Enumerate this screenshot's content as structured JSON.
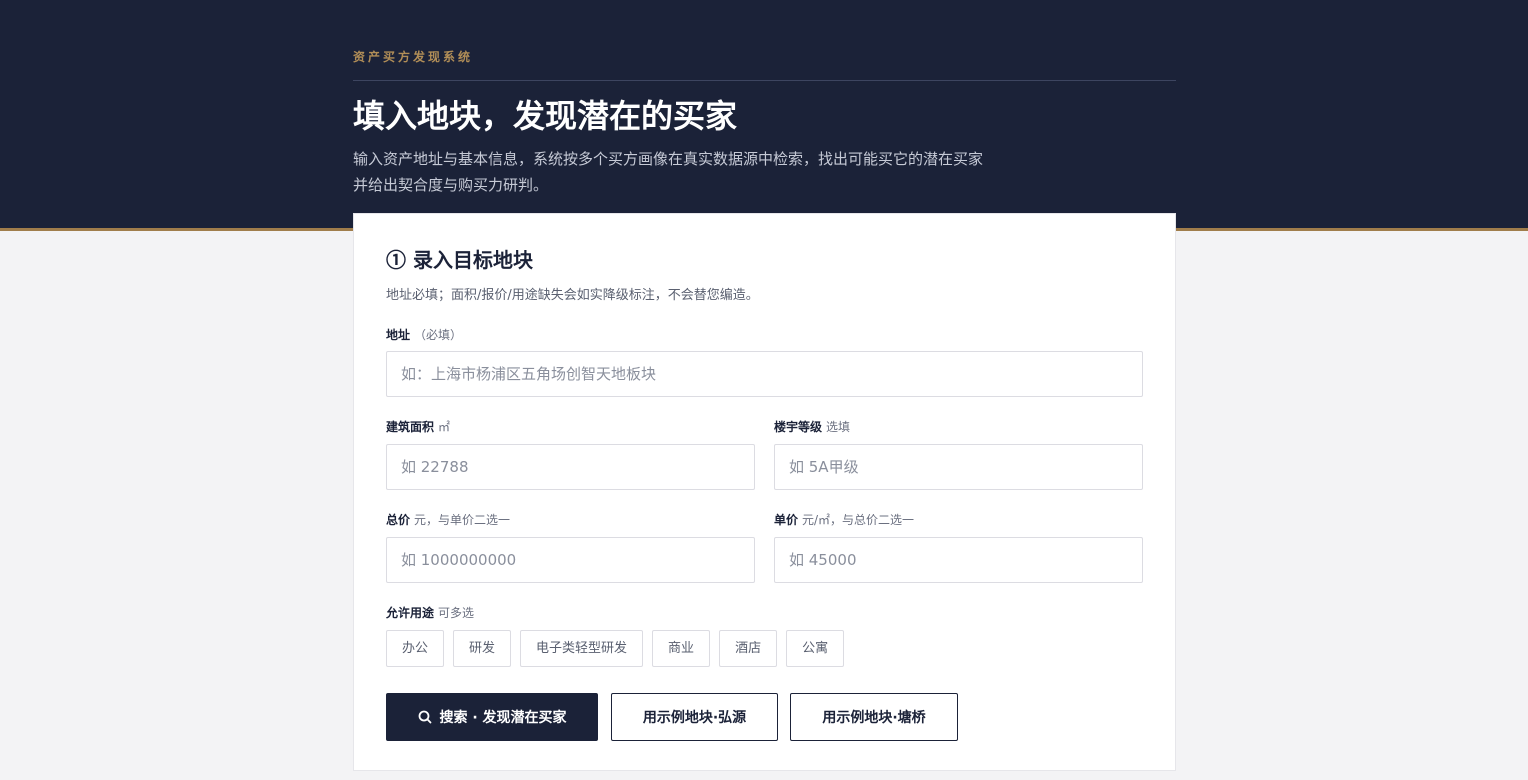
{
  "header": {
    "eyebrow": "资产买方发现系统",
    "title": "填入地块，发现潜在的买家",
    "description": "输入资产地址与基本信息，系统按多个买方画像在真实数据源中检索，找出可能买它的潜在买家并给出契合度与购买力研判。"
  },
  "form": {
    "title": "① 录入目标地块",
    "subtitle": "地址必填；面积/报价/用途缺失会如实降级标注，不会替您编造。",
    "address": {
      "label": "地址",
      "hint": "（必填）",
      "placeholder": "如：上海市杨浦区五角场创智天地板块"
    },
    "area": {
      "label": "建筑面积",
      "hint": "㎡",
      "placeholder": "如 22788"
    },
    "grade": {
      "label": "楼宇等级",
      "hint": "选填",
      "placeholder": "如 5A甲级"
    },
    "total_price": {
      "label": "总价",
      "hint": "元，与单价二选一",
      "placeholder": "如 1000000000"
    },
    "unit_price": {
      "label": "单价",
      "hint": "元/㎡，与总价二选一",
      "placeholder": "如 45000"
    },
    "usage": {
      "label": "允许用途",
      "hint": "可多选",
      "options": [
        "办公",
        "研发",
        "电子类轻型研发",
        "商业",
        "酒店",
        "公寓"
      ]
    },
    "buttons": {
      "search": "搜索 · 发现潜在买家",
      "example1": "用示例地块·弘源",
      "example2": "用示例地块·塘桥"
    }
  },
  "colors": {
    "navy": "#1b2238",
    "gold": "#a07d4b",
    "background": "#f3f3f5"
  }
}
